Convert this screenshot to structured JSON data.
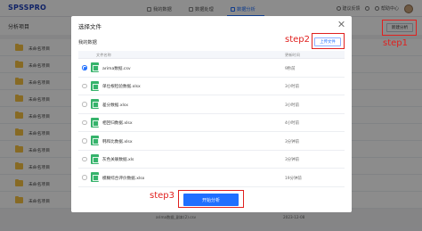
{
  "app": {
    "logo": "SPSSPRO",
    "nav_tabs": [
      {
        "label": "我的数据",
        "active": false
      },
      {
        "label": "数据处理",
        "active": false
      },
      {
        "label": "数据分析",
        "active": true
      }
    ],
    "top_right": {
      "suggestion": "建议反馈",
      "help": "帮助中心"
    }
  },
  "background_page": {
    "title": "分析项目",
    "new_button": "新建分析",
    "items": [
      {
        "label": "未命名项目"
      },
      {
        "label": "未命名项目"
      },
      {
        "label": "未命名项目"
      },
      {
        "label": "未命名项目"
      },
      {
        "label": "未命名项目"
      },
      {
        "label": "未命名项目"
      },
      {
        "label": "未命名项目"
      },
      {
        "label": "未命名项目"
      },
      {
        "label": "未命名项目"
      },
      {
        "label": "未命名项目"
      }
    ],
    "bottom_file_name": "arima数据_副本(2).csv",
    "bottom_file_time": "2023-12-08"
  },
  "modal": {
    "title": "选择文件",
    "subtitle": "我的数据",
    "upload_button": "上传文件",
    "columns": {
      "name": "文件名称",
      "time": "更新时间"
    },
    "files": [
      {
        "name": "arima数据.csv",
        "time": "9秒前",
        "selected": true
      },
      {
        "name": "单位根检验数据.xlsx",
        "time": "3小时前",
        "selected": false
      },
      {
        "name": "差分数据.xlsx",
        "time": "3小时前",
        "selected": false
      },
      {
        "name": "相回归数据.xlsx",
        "time": "4小时前",
        "selected": false
      },
      {
        "name": "韩和比数据.xlsx",
        "time": "3分钟前",
        "selected": false
      },
      {
        "name": "灰色关联数据.xls",
        "time": "3分钟前",
        "selected": false
      },
      {
        "name": "模糊综合评价数据.xlsx",
        "time": "19分钟前",
        "selected": false
      }
    ],
    "start_button": "开始分析"
  },
  "annotations": {
    "step1": "step1",
    "step2": "step2",
    "step3": "step3",
    "color": "#e0201e"
  },
  "colors": {
    "accent": "#1f6fff",
    "folder": "#f6c243",
    "file": "#35b36b"
  }
}
